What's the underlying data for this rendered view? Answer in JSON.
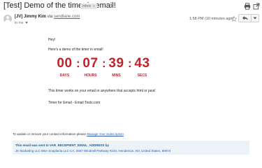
{
  "email": {
    "subject": "[Test] Demo of the timer in email!",
    "label_badge": "Inbox",
    "label_remove_glyph": "x",
    "sender_name": "[JV] Jimmy Kim",
    "via_text": "via",
    "via_domain": "sendlane.com",
    "to_text": "to me",
    "timestamp": "1:58 PM (10 minutes ago)",
    "icons": {
      "print": "print-icon",
      "popout": "popout-icon",
      "star": "star-icon",
      "reply": "reply-icon",
      "more": "chevron-down-icon",
      "avatar": "avatar-icon"
    }
  },
  "message": {
    "greeting": "Hey!",
    "intro": "Here's a demo of the timer in email!",
    "timer": {
      "days": "00",
      "hours": "07",
      "mins": "39",
      "secs": "43",
      "separator": ":",
      "labels": {
        "days": "DAYS",
        "hours": "HOURS",
        "mins": "MINS",
        "secs": "SECS"
      },
      "color": "#c1232b"
    },
    "line1": "This timer works on your email or anywhere that accepts html or java!",
    "line2": "Timer for Email - Email Tools.com"
  },
  "footer": {
    "update_text": "To update or remove your contact information please",
    "update_link": "Manage Your Subscription",
    "recipient_text": "This email was sent to VAR_RECEPIENT_EMAIL_ADDRESS by",
    "address_text": "JK Marketing LLC DBA Snaplacta LLC CA, 2657 Windmill Parkway #233, Henderson, NV, United States, 89074"
  }
}
